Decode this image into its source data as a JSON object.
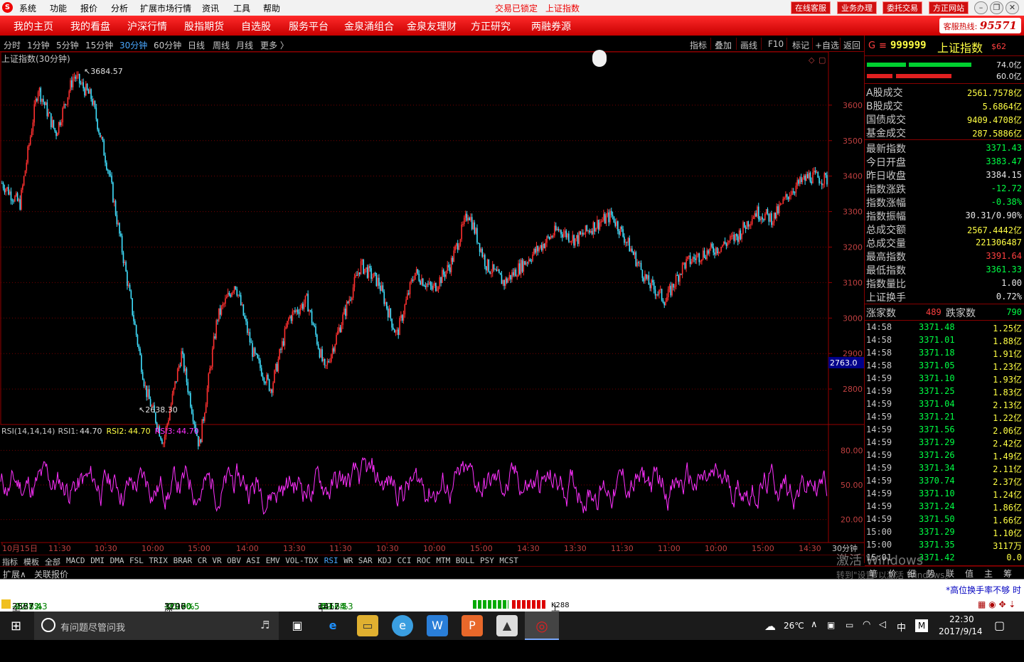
{
  "titlebar": {
    "menu": [
      "系统",
      "功能",
      "报价",
      "分析",
      "扩展市场行情",
      "资讯",
      "工具",
      "帮助"
    ],
    "lock_status": "交易已锁定",
    "current": "上证指数",
    "buttons": [
      "在线客服",
      "业务办理",
      "委托交易",
      "方正网站"
    ]
  },
  "nav": {
    "items": [
      "我的主页",
      "我的看盘",
      "沪深行情",
      "股指期货",
      "自选股",
      "服务平台",
      "金泉涌组合",
      "金泉友理财",
      "方正研究",
      "两融券源"
    ],
    "hotline_label": "客服热线:",
    "hotline_num": "95571"
  },
  "periods": {
    "items": [
      "分时",
      "1分钟",
      "5分钟",
      "15分钟",
      "30分钟",
      "60分钟",
      "日线",
      "周线",
      "月线",
      "更多 〉"
    ],
    "selected": "30分钟"
  },
  "tools": [
    "指标",
    "叠加",
    "画线",
    "F10",
    "标记",
    "+自选",
    "返回"
  ],
  "main_chart": {
    "label": "上证指数(30分钟)",
    "high_mark": "3684.57",
    "low_mark": "2638.30",
    "cursor_price": "2763.0",
    "y_ticks": [
      "3600",
      "3500",
      "3400",
      "3300",
      "3200",
      "3100",
      "3000",
      "2900",
      "2800"
    ],
    "up_color": "#ff3030",
    "down_color": "#40e0ff"
  },
  "rsi": {
    "label": "RSI(14,14,14)",
    "rsi1_label": "RSI1:",
    "rsi1": "44.70",
    "rsi2_label": "RSI2:",
    "rsi2": "44.70",
    "rsi3_label": "RSI3:",
    "rsi3": "44.70",
    "y_ticks": [
      "80.00",
      "50.00",
      "20.00"
    ],
    "line_color": "#ff30ff"
  },
  "x_axis": {
    "labels": [
      "10月15日",
      "11:30",
      "10:30",
      "10:00",
      "15:00",
      "14:00",
      "13:30",
      "11:30",
      "10:30",
      "10:00",
      "15:00",
      "14:30",
      "13:30",
      "11:30",
      "11:00",
      "10:00",
      "15:00",
      "14:30"
    ],
    "period": "30分钟"
  },
  "indicator_tabs": {
    "items": [
      "指标",
      "模板",
      "全部",
      "MACD",
      "DMI",
      "DMA",
      "FSL",
      "TRIX",
      "BRAR",
      "CR",
      "VR",
      "OBV",
      "ASI",
      "EMV",
      "VOL-TDX",
      "RSI",
      "WR",
      "SAR",
      "KDJ",
      "CCI",
      "ROC",
      "MTM",
      "BOLL",
      "PSY",
      "MCST"
    ],
    "selected": "RSI"
  },
  "extension": {
    "items": [
      "扩展∧",
      "关联报价"
    ]
  },
  "right_panel": {
    "code": "999999",
    "name": "上证指数",
    "badge": "$62",
    "g_label": "G",
    "menu_icon": "≡",
    "ratios": [
      "74.0亿",
      "60.0亿"
    ],
    "turnover": [
      {
        "label": "A股成交",
        "value": "2561.7578亿"
      },
      {
        "label": "B股成交",
        "value": "5.6864亿"
      },
      {
        "label": "国债成交",
        "value": "9409.4708亿"
      },
      {
        "label": "基金成交",
        "value": "287.5886亿"
      }
    ],
    "quotes": [
      {
        "label": "最新指数",
        "value": "3371.43",
        "color": "g"
      },
      {
        "label": "今日开盘",
        "value": "3383.47",
        "color": "g"
      },
      {
        "label": "昨日收盘",
        "value": "3384.15",
        "color": "w"
      },
      {
        "label": "指数涨跌",
        "value": "-12.72",
        "color": "g"
      },
      {
        "label": "指数涨幅",
        "value": "-0.38%",
        "color": "g"
      },
      {
        "label": "指数振幅",
        "value": "30.31/0.90%",
        "color": "w"
      },
      {
        "label": "总成交额",
        "value": "2567.4442亿",
        "color": "y"
      },
      {
        "label": "总成交量",
        "value": "221306487",
        "color": "y"
      },
      {
        "label": "最高指数",
        "value": "3391.64",
        "color": "r"
      },
      {
        "label": "最低指数",
        "value": "3361.33",
        "color": "g"
      },
      {
        "label": "指数量比",
        "value": "1.00",
        "color": "w"
      },
      {
        "label": "上证换手",
        "value": "0.72%",
        "color": "w"
      }
    ],
    "breadth": {
      "up_label": "涨家数",
      "up": "489",
      "down_label": "跌家数",
      "down": "790"
    },
    "ticks": [
      {
        "t": "14:58",
        "p": "3371.48",
        "a": "1.25亿"
      },
      {
        "t": "14:58",
        "p": "3371.01",
        "a": "1.88亿"
      },
      {
        "t": "14:58",
        "p": "3371.18",
        "a": "1.91亿"
      },
      {
        "t": "14:58",
        "p": "3371.05",
        "a": "1.23亿"
      },
      {
        "t": "14:59",
        "p": "3371.10",
        "a": "1.93亿"
      },
      {
        "t": "14:59",
        "p": "3371.25",
        "a": "1.83亿"
      },
      {
        "t": "14:59",
        "p": "3371.04",
        "a": "2.13亿"
      },
      {
        "t": "14:59",
        "p": "3371.21",
        "a": "1.22亿"
      },
      {
        "t": "14:59",
        "p": "3371.56",
        "a": "2.06亿"
      },
      {
        "t": "14:59",
        "p": "3371.29",
        "a": "2.42亿"
      },
      {
        "t": "14:59",
        "p": "3371.26",
        "a": "1.49亿"
      },
      {
        "t": "14:59",
        "p": "3371.34",
        "a": "2.11亿"
      },
      {
        "t": "14:59",
        "p": "3370.74",
        "a": "2.37亿"
      },
      {
        "t": "14:59",
        "p": "3371.10",
        "a": "1.24亿"
      },
      {
        "t": "14:59",
        "p": "3371.24",
        "a": "1.86亿"
      },
      {
        "t": "14:59",
        "p": "3371.50",
        "a": "1.66亿"
      },
      {
        "t": "15:00",
        "p": "3371.29",
        "a": "1.10亿"
      },
      {
        "t": "15:00",
        "p": "3371.35",
        "a": "3117万"
      },
      {
        "t": "15:01",
        "p": "3371.42",
        "a": "0.0"
      }
    ],
    "bottom_tabs": [
      "笔",
      "价",
      "细",
      "势",
      "联",
      "值",
      "主",
      "筹"
    ],
    "watermark1": "激活 Windows",
    "watermark2": "转到\"设置\"以激活 Windows。"
  },
  "scroll_msg": "*高位换手率不够 时",
  "statusbar": [
    {
      "label": "上证",
      "val": "3371.43",
      "chg": "-12.72",
      "pct": "-0.38%",
      "amt": "2567亿"
    },
    {
      "label": "深证",
      "val": "11070.5",
      "chg": "-21.00",
      "pct": "-0.19%",
      "amt": "3296亿"
    },
    {
      "label": "中小",
      "val": "7517.13",
      "chg": "-49.64",
      "pct": "-0.66%",
      "amt": "1412亿"
    }
  ],
  "cloud_label": "上证云行情",
  "cloud_num": "K288",
  "taskbar": {
    "search_placeholder": "有问题尽管问我",
    "temp": "26℃",
    "ime": "中",
    "time": "22:30",
    "date": "2017/9/14"
  },
  "chart_data": {
    "type": "line",
    "title": "上证指数(30分钟)",
    "x": [
      "10月15日",
      "11:30",
      "10:30",
      "10:00",
      "15:00",
      "14:00",
      "13:30",
      "11:30",
      "10:30",
      "10:00",
      "15:00",
      "14:30",
      "13:30",
      "11:30",
      "11:00",
      "10:00",
      "15:00",
      "14:30"
    ],
    "price_path": [
      3380,
      3320,
      3650,
      3520,
      3684,
      3620,
      3400,
      3100,
      2800,
      2650,
      2900,
      2638,
      3000,
      3100,
      2900,
      2800,
      3000,
      3050,
      2850,
      3000,
      3150,
      3100,
      2950,
      3130,
      3080,
      3150,
      3300,
      3150,
      3100,
      3150,
      3200,
      3250,
      3220,
      3260,
      3290,
      3200,
      3100,
      3050,
      3150,
      3180,
      3200,
      3230,
      3300,
      3280,
      3360,
      3400,
      3390
    ],
    "ylim": [
      2700,
      3750
    ],
    "rsi_ylim": [
      0,
      100
    ]
  }
}
